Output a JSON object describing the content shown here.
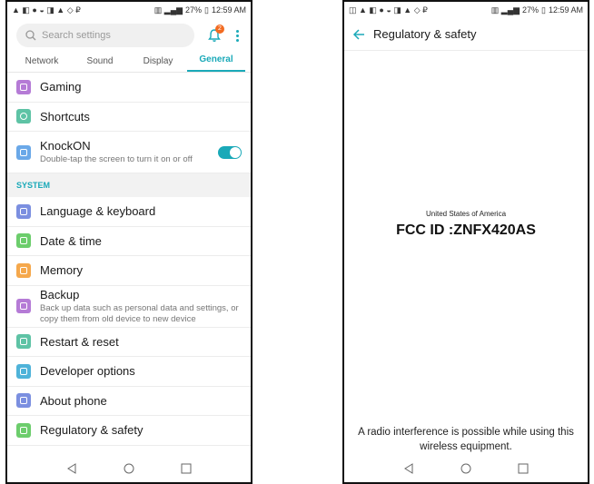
{
  "left": {
    "status": {
      "left_icons": "▲ ◧ ● ◒ ◨ ▲ ◇ ₽",
      "battery": "27%",
      "time": "12:59 AM"
    },
    "search": {
      "placeholder": "Search settings"
    },
    "notification_count": "2",
    "tabs": [
      {
        "label": "Network"
      },
      {
        "label": "Sound"
      },
      {
        "label": "Display"
      },
      {
        "label": "General",
        "active": true
      }
    ],
    "items_top": [
      {
        "title": "Gaming",
        "icon": "gaming-icon",
        "color": "#b57bd6"
      },
      {
        "title": "Shortcuts",
        "icon": "shortcuts-icon",
        "color": "#5ec3a5"
      }
    ],
    "knockon": {
      "title": "KnockON",
      "subtitle": "Double-tap the screen to turn it on or off",
      "enabled": true,
      "color": "#6aa8e8"
    },
    "section": "SYSTEM",
    "items_system": [
      {
        "title": "Language & keyboard",
        "icon": "language-icon",
        "color": "#7b8fe0"
      },
      {
        "title": "Date & time",
        "icon": "clock-icon",
        "color": "#6ccd6c"
      },
      {
        "title": "Memory",
        "icon": "memory-icon",
        "color": "#f5a84c"
      }
    ],
    "backup": {
      "title": "Backup",
      "subtitle": "Back up data such as personal data and settings, or copy them from old device to new device",
      "color": "#b57bd6"
    },
    "items_bottom": [
      {
        "title": "Restart & reset",
        "icon": "restart-icon",
        "color": "#5ec3a5"
      },
      {
        "title": "Developer options",
        "icon": "developer-icon",
        "color": "#4fb3d9"
      },
      {
        "title": "About phone",
        "icon": "about-icon",
        "color": "#7b8fe0"
      },
      {
        "title": "Regulatory & safety",
        "icon": "regulatory-icon",
        "color": "#6ccd6c"
      }
    ]
  },
  "right": {
    "status": {
      "left_icons": "◫ ▲ ◧ ● ◒ ◨ ▲ ◇ ₽",
      "battery": "27%",
      "time": "12:59 AM"
    },
    "title": "Regulatory & safety",
    "region": "United States of America",
    "fcc_id": "FCC ID :ZNFX420AS",
    "note": "A radio interference is possible while using this wireless equipment."
  },
  "colors": {
    "accent": "#1aa9b8"
  }
}
